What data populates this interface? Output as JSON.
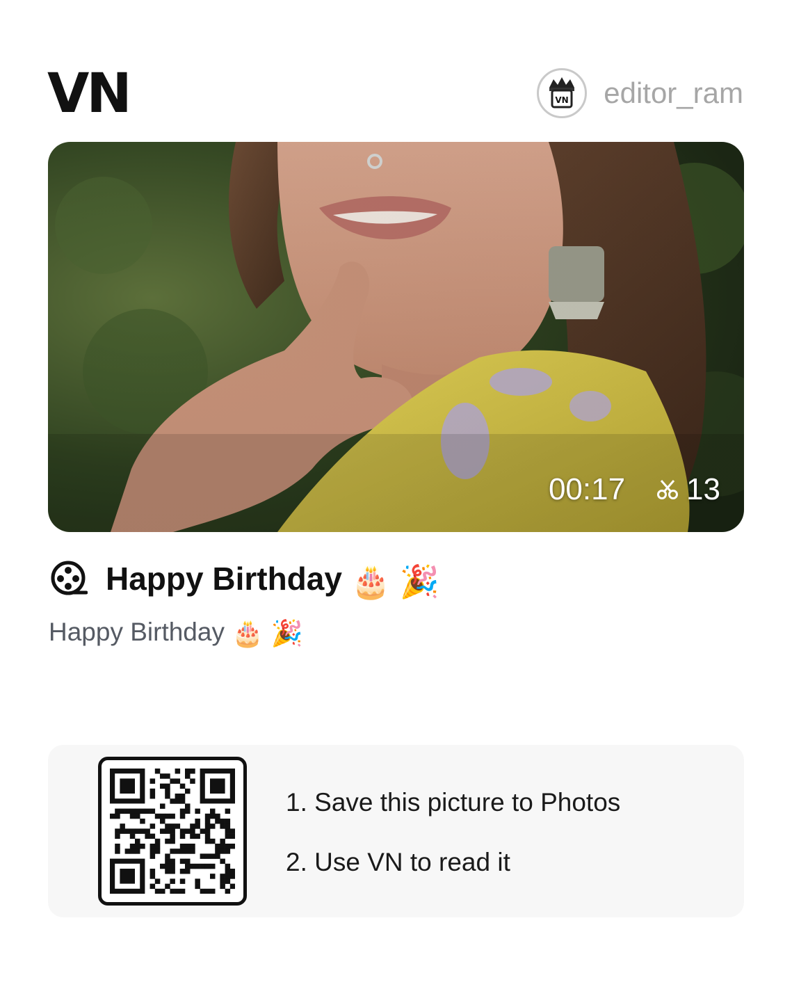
{
  "header": {
    "logo_text": "VN",
    "username": "editor_ram",
    "avatar_icon": "vn-crown-avatar-icon"
  },
  "media": {
    "duration": "00:17",
    "clip_count": "13",
    "clip_icon": "scissors-icon"
  },
  "post": {
    "title": "Happy Birthday",
    "title_icon": "film-reel-icon",
    "description": "Happy Birthday",
    "emojis": [
      "🎂",
      "🎉"
    ]
  },
  "qr_panel": {
    "step_1": "1. Save this picture to Photos",
    "step_2": "2. Use VN to read it"
  },
  "colors": {
    "username_gray": "#a6a6a6",
    "subtitle_gray": "#555a63",
    "panel_bg": "#f7f7f7",
    "dress_yellow": "#d8c544"
  }
}
